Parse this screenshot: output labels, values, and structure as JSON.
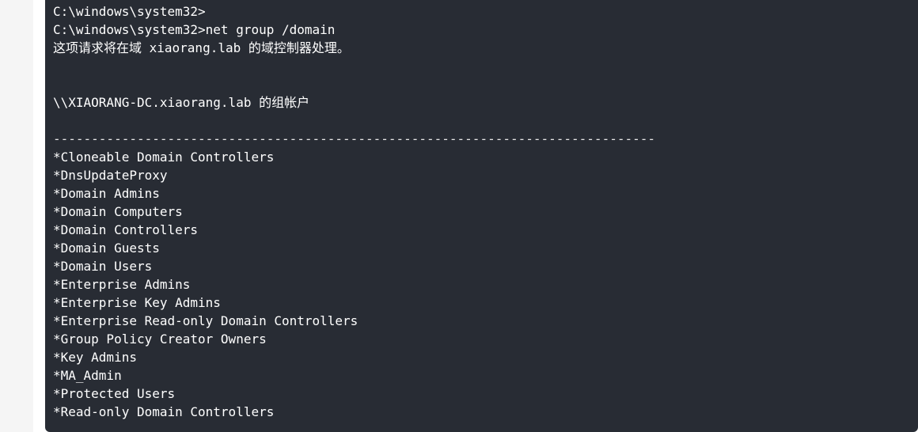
{
  "code_block": {
    "lines": [
      "C:\\windows\\system32>",
      "C:\\windows\\system32>net group /domain",
      "这项请求将在域 xiaorang.lab 的域控制器处理。",
      "",
      "",
      "\\\\XIAORANG-DC.xiaorang.lab 的组帐户",
      "",
      "-------------------------------------------------------------------------------",
      "*Cloneable Domain Controllers",
      "*DnsUpdateProxy",
      "*Domain Admins",
      "*Domain Computers",
      "*Domain Controllers",
      "*Domain Guests",
      "*Domain Users",
      "*Enterprise Admins",
      "*Enterprise Key Admins",
      "*Enterprise Read-only Domain Controllers",
      "*Group Policy Creator Owners",
      "*Key Admins",
      "*MA_Admin",
      "*Protected Users",
      "*Read-only Domain Controllers"
    ]
  },
  "colors": {
    "code_background": "#282c34",
    "code_text": "#ffffff",
    "gutter": "#f5f5f5"
  }
}
